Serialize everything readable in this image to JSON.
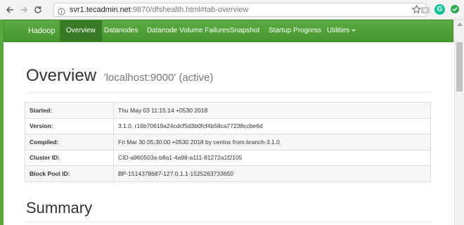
{
  "browser": {
    "url_host": "svr1.tecadmin.net",
    "url_rest": ":9870/dfshealth.html#tab-overview",
    "extension_g_label": "G"
  },
  "navbar": {
    "brand": "Hadoop",
    "items": [
      {
        "label": "Overview"
      },
      {
        "label": "Datanodes"
      },
      {
        "label": "Datanode Volume Failures"
      },
      {
        "label": "Snapshot"
      },
      {
        "label": "Startup Progress"
      },
      {
        "label": "Utilities"
      }
    ],
    "colors": {
      "bar": "#4d9e36",
      "active": "#3a7a26"
    }
  },
  "overview": {
    "title": "Overview",
    "subtitle": "'localhost:9000' (active)",
    "rows": [
      {
        "key": "Started:",
        "value": "Thu May 03 11:15:14 +0530 2018"
      },
      {
        "key": "Version:",
        "value": "3.1.0, r16b70619a24cdcf5d3b0fcf4b58ca77238ccbe6d"
      },
      {
        "key": "Compiled:",
        "value": "Fri Mar 30 05:30:00 +0530 2018 by centos from branch-3.1.0"
      },
      {
        "key": "Cluster ID:",
        "value": "CID-a960503a-b8a1-4a98-a111-81272a1f2105"
      },
      {
        "key": "Block Pool ID:",
        "value": "BP-1514378687-127.0.1.1-1525263733650"
      }
    ]
  },
  "summary": {
    "title": "Summary"
  }
}
